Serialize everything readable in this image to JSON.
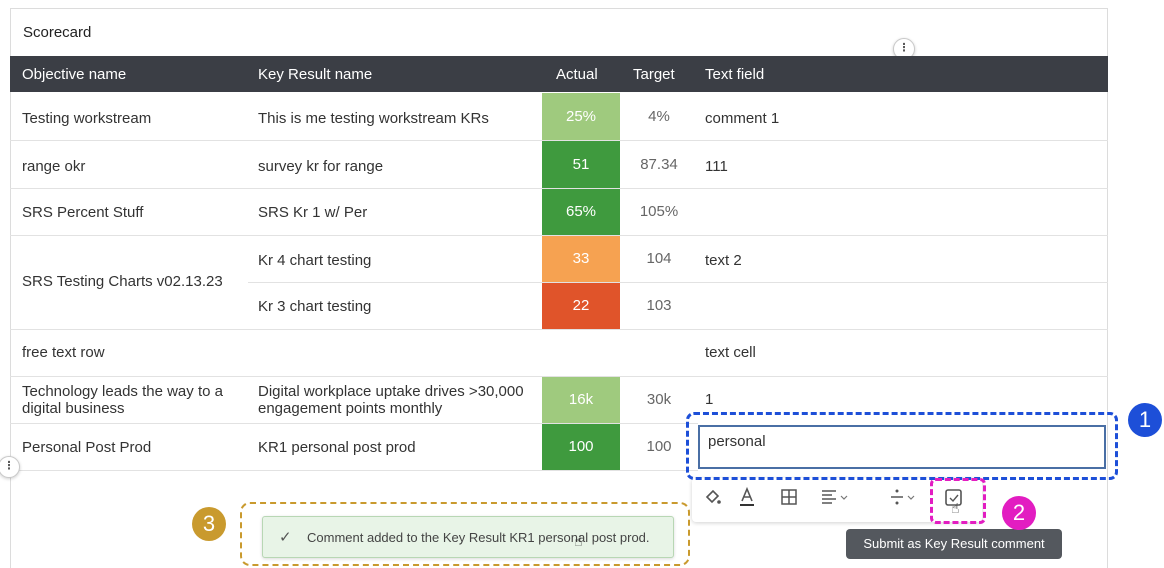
{
  "scorecard": {
    "title": "Scorecard"
  },
  "columns": {
    "objective": "Objective name",
    "key_result": "Key Result name",
    "actual": "Actual",
    "target": "Target",
    "text_field": "Text field"
  },
  "rows": [
    {
      "objective": "Testing workstream",
      "key_result": "This is me testing workstream KRs",
      "actual": "25%",
      "actual_color": "#9fca7e",
      "target": "4%",
      "text": "comment 1"
    },
    {
      "objective": "range okr",
      "key_result": "survey kr for range",
      "actual": "51",
      "actual_color": "#3f9a3e",
      "target": "87.34",
      "text": "111"
    },
    {
      "objective": "SRS Percent Stuff",
      "key_result": "SRS Kr 1 w/ Per",
      "actual": "65%",
      "actual_color": "#3f9a3e",
      "target": "105%",
      "text": ""
    },
    {
      "objective": "SRS Testing Charts v02.13.23",
      "key_result": "Kr 4 chart testing",
      "actual": "33",
      "actual_color": "#f6a251",
      "target": "104",
      "text": "text 2"
    },
    {
      "objective": "",
      "key_result": "Kr 3 chart testing",
      "actual": "22",
      "actual_color": "#e0542a",
      "target": "103",
      "text": ""
    },
    {
      "objective": "free text row",
      "key_result": "",
      "actual": "",
      "actual_color": "",
      "target": "",
      "text": "text cell"
    },
    {
      "objective": "Technology leads the way to a digital business",
      "key_result": "Digital workplace uptake drives >30,000 engagement points monthly",
      "actual": "16k",
      "actual_color": "#9fca7e",
      "target": "30k",
      "text": "1"
    },
    {
      "objective": "Personal Post Prod",
      "key_result": "KR1 personal post prod",
      "actual": "100",
      "actual_color": "#3f9a3e",
      "target": "100",
      "text": "personal"
    }
  ],
  "toolbar": {
    "fill_icon": "paint-bucket-icon",
    "text_color_icon": "text-color-icon",
    "table_icon": "grid-icon",
    "align_icon": "align-icon",
    "divide_icon": "divide-icon",
    "submit_icon": "comment-submit-icon"
  },
  "tooltip": {
    "text": "Submit as Key Result comment"
  },
  "toast": {
    "message": "Comment added to the Key Result KR1 personal post prod."
  },
  "annotations": {
    "badge1": "1",
    "badge1_color": "#1d4fd8",
    "badge2": "2",
    "badge2_color": "#e21dc1",
    "badge3": "3",
    "badge3_color": "#c99a2e"
  },
  "handles": {
    "top": "⋮",
    "left": "⋮"
  }
}
